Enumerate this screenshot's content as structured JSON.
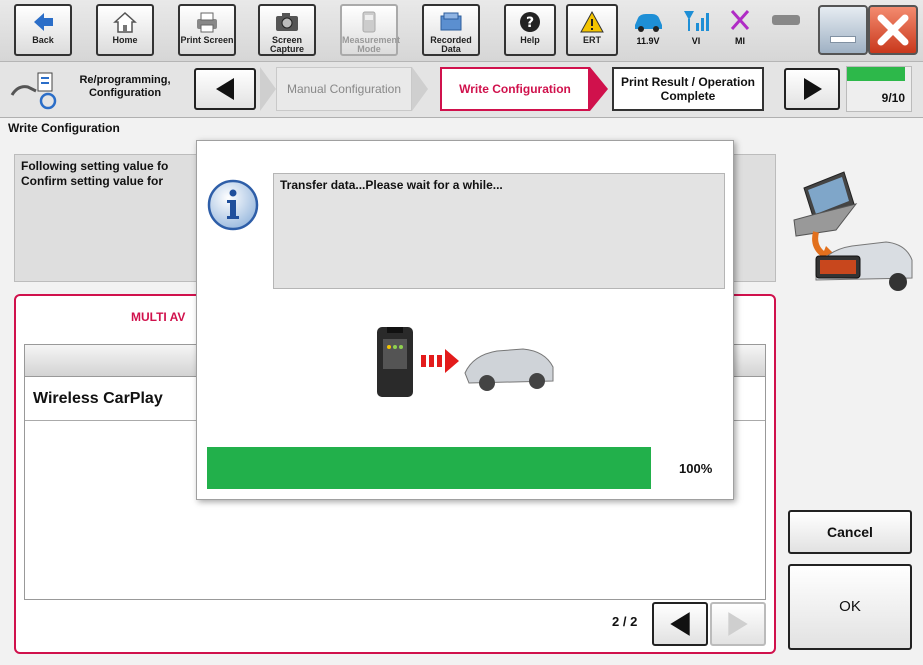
{
  "toolbar": {
    "back": "Back",
    "home": "Home",
    "print_screen": "Print Screen",
    "screen_capture": "Screen Capture",
    "measurement_mode": "Measurement Mode",
    "recorded_data": "Recorded Data",
    "help": "Help",
    "ert": "ERT",
    "voltage": "11.9V",
    "vi": "VI",
    "mi": "MI"
  },
  "stepbar": {
    "title": "Re/programming, Configuration",
    "steps": [
      {
        "label": "Manual Configuration",
        "state": "inactive"
      },
      {
        "label": "Write Configuration",
        "state": "active"
      },
      {
        "label": "Print Result / Operation Complete",
        "state": "next"
      }
    ],
    "progress_label": "9/10",
    "progress_fraction": 0.9
  },
  "main": {
    "section_title": "Write Configuration",
    "message_line1": "Following setting value fo",
    "message_line2": "Confirm setting value for",
    "panel_title": "MULTI AV",
    "list_rows": [
      "Wireless CarPlay"
    ],
    "page_indicator": "2 / 2",
    "cancel_label": "Cancel",
    "ok_label": "OK"
  },
  "dialog": {
    "message": "Transfer data...Please wait for a while...",
    "progress_percent": 100,
    "progress_label": "100%"
  },
  "colors": {
    "accent": "#d0114c",
    "progress": "#22b04b",
    "close": "#d9482a"
  }
}
